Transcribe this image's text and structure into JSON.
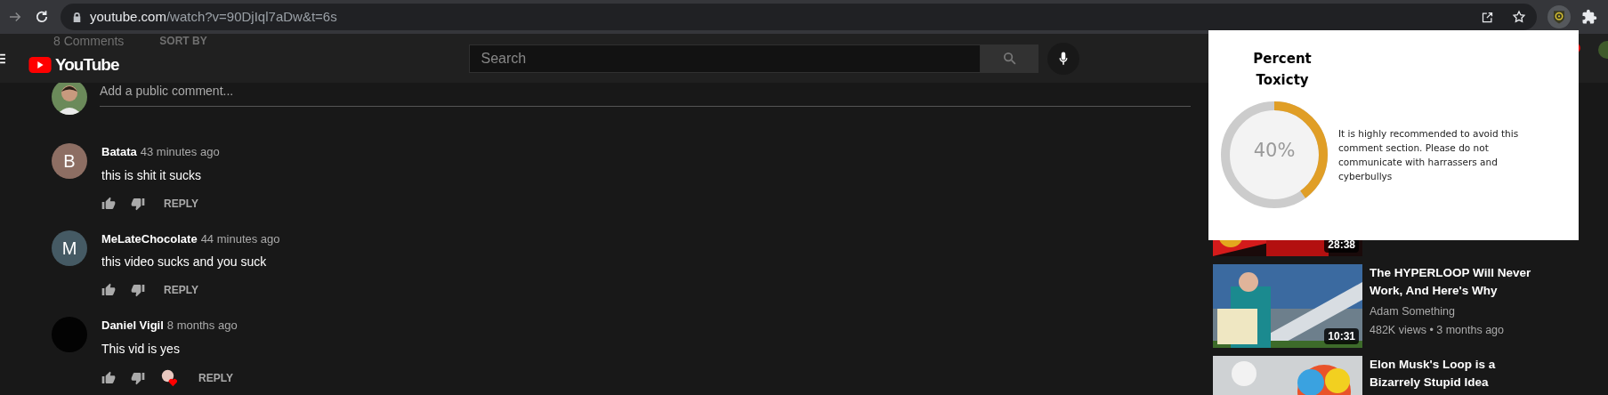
{
  "browser": {
    "url_host": "youtube.com",
    "url_path": "/watch?v=90DjIql7aDw&t=6s"
  },
  "header": {
    "logo": "YouTube",
    "search": {
      "placeholder": "Search"
    },
    "behind": [
      "8 Comments",
      "SORT BY"
    ]
  },
  "comment_box": {
    "placeholder": "Add a public comment..."
  },
  "comments": [
    {
      "author": "Batata",
      "time": "43 minutes ago",
      "text": "this is shit it sucks",
      "avatar_letter": "B",
      "color": "#8d6e63",
      "hearted": false,
      "reply": "REPLY"
    },
    {
      "author": "MeLateChocolate",
      "time": "44 minutes ago",
      "text": "this video sucks and you suck",
      "avatar_letter": "M",
      "color": "#455a64",
      "hearted": false,
      "reply": "REPLY"
    },
    {
      "author": "Daniel Vigil",
      "time": "8 months ago",
      "text": "This vid is yes",
      "color": "#030303",
      "hearted": true,
      "reply": "REPLY"
    }
  ],
  "popup": {
    "title": "Percent Toxicty",
    "level": 0.4,
    "reading": "40%",
    "message": "It is highly recommended to avoid this comment section. Please do not communicate with harrassers and cyberbullys"
  },
  "videos": [
    {
      "duration": "28:38"
    },
    {
      "title": "The HYPERLOOP Will Never Work, And Here's Why",
      "channel": "Adam Something",
      "meta": "482K views • 3 months ago",
      "duration": "10:31"
    },
    {
      "title": "Elon Musk's Loop is a Bizarrely Stupid Idea"
    }
  ]
}
